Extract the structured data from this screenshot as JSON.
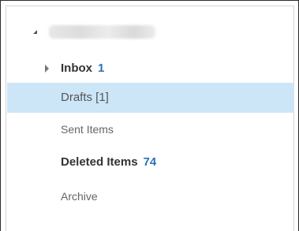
{
  "folder_pane": {
    "account": {
      "name": "",
      "caret_icon": "expanded-caret-icon"
    },
    "folders": [
      {
        "label": "Inbox",
        "count": "1",
        "icon": "collapsed-arrow-icon"
      },
      {
        "label": "Drafts [1]",
        "count": "",
        "selected": true
      },
      {
        "label": "Sent Items",
        "count": ""
      },
      {
        "label": "Deleted Items",
        "count": "74"
      },
      {
        "label": "Archive",
        "count": ""
      }
    ]
  },
  "colors": {
    "selected_bg": "#cde6f7",
    "count_color": "#2a73b7"
  }
}
